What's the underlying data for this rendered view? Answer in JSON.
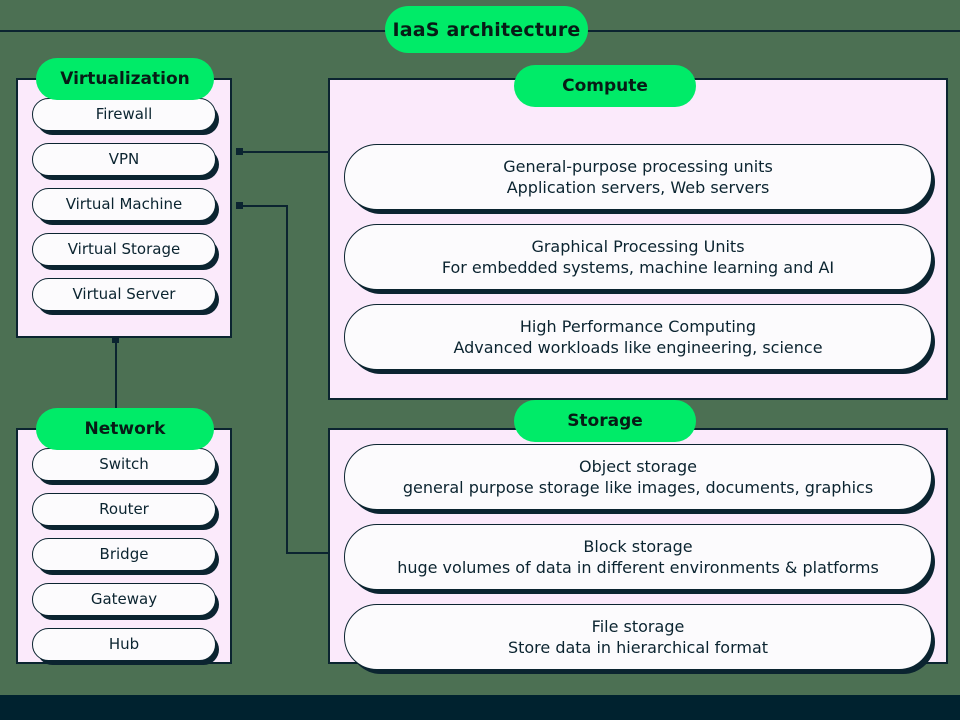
{
  "title": "IaaS architecture",
  "theme": {
    "background": "#4c7053",
    "panel_fill": "#fbeafb",
    "pill_green": "#00eb68",
    "ink": "#0b2430",
    "card_fill": "#fcfbfd",
    "bottom_band": "#00222f"
  },
  "sections": {
    "virtualization": {
      "label": "Virtualization",
      "items": [
        {
          "line1": "Firewall"
        },
        {
          "line1": "VPN"
        },
        {
          "line1": "Virtual Machine"
        },
        {
          "line1": "Virtual Storage"
        },
        {
          "line1": "Virtual Server"
        }
      ]
    },
    "network": {
      "label": "Network",
      "items": [
        {
          "line1": "Switch"
        },
        {
          "line1": "Router"
        },
        {
          "line1": "Bridge"
        },
        {
          "line1": "Gateway"
        },
        {
          "line1": "Hub"
        }
      ]
    },
    "compute": {
      "label": "Compute",
      "items": [
        {
          "line1": "General-purpose processing units",
          "line2": "Application servers, Web servers"
        },
        {
          "line1": "Graphical Processing Units",
          "line2": "For embedded systems, machine learning and AI"
        },
        {
          "line1": "High Performance Computing",
          "line2": "Advanced workloads like engineering, science"
        }
      ]
    },
    "storage": {
      "label": "Storage",
      "items": [
        {
          "line1": "Object storage",
          "line2": "general purpose storage like images, documents, graphics"
        },
        {
          "line1": "Block storage",
          "line2": "huge volumes of data in different environments & platforms"
        },
        {
          "line1": "File storage",
          "line2": "Store data in hierarchical format"
        }
      ]
    }
  }
}
